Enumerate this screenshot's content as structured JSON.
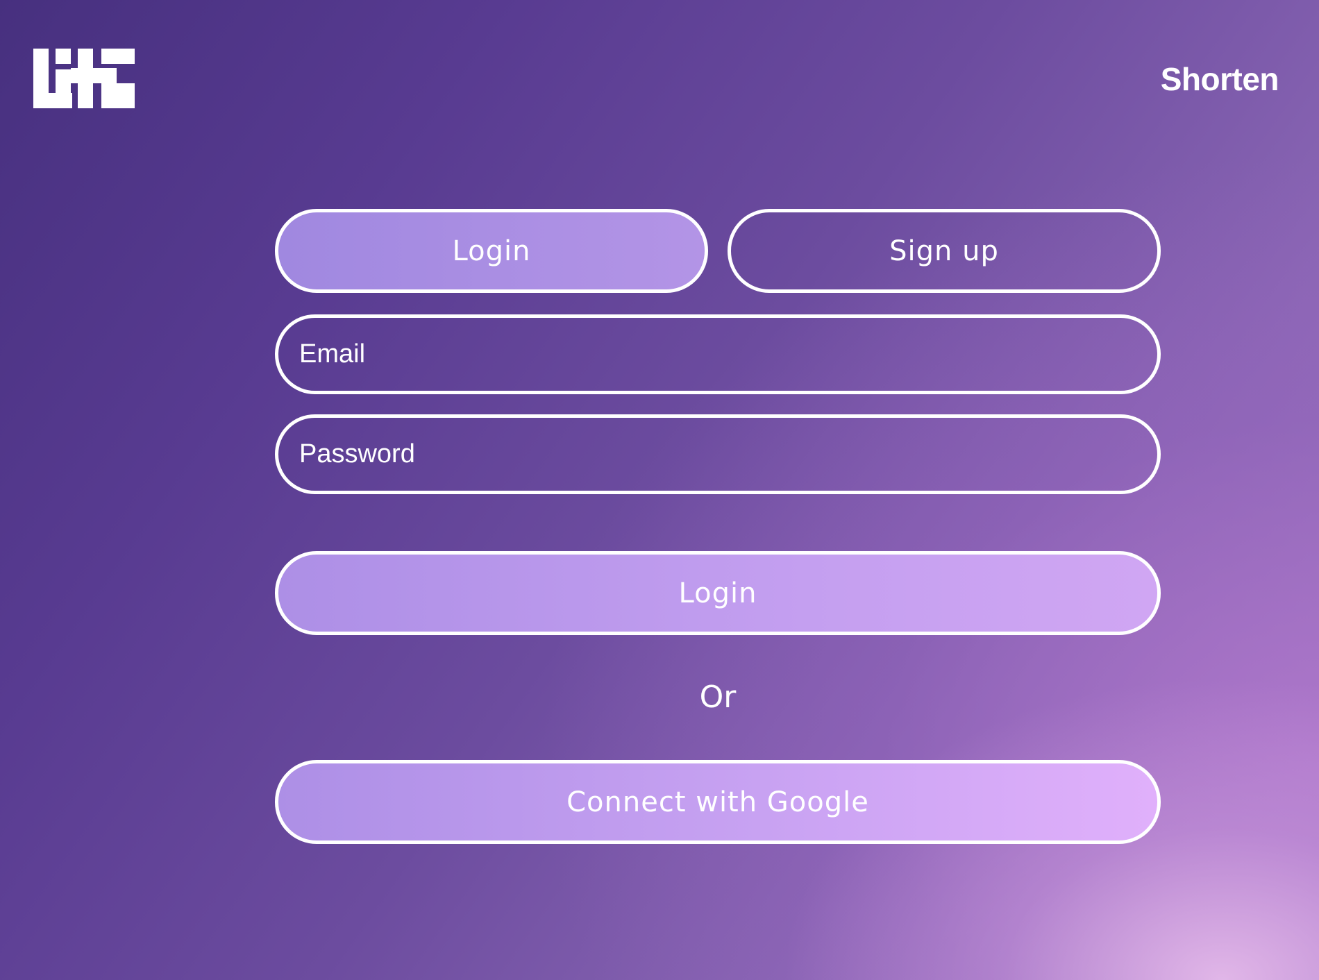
{
  "header": {
    "nav_link": "Shorten"
  },
  "auth": {
    "tabs": [
      {
        "label": "Login",
        "active": true
      },
      {
        "label": "Sign up",
        "active": false
      }
    ],
    "fields": {
      "email": {
        "placeholder": "Email",
        "value": ""
      },
      "password": {
        "placeholder": "Password",
        "value": ""
      }
    },
    "submit_label": "Login",
    "divider_text": "Or",
    "google_label": "Connect with Google"
  },
  "colors": {
    "background_start": "#47307f",
    "background_end": "#a17ac2",
    "active_tab": "#a88de3",
    "border": "#ffffff",
    "text": "#ffffff"
  },
  "icons": {
    "logo": "brand-logo-icon"
  }
}
